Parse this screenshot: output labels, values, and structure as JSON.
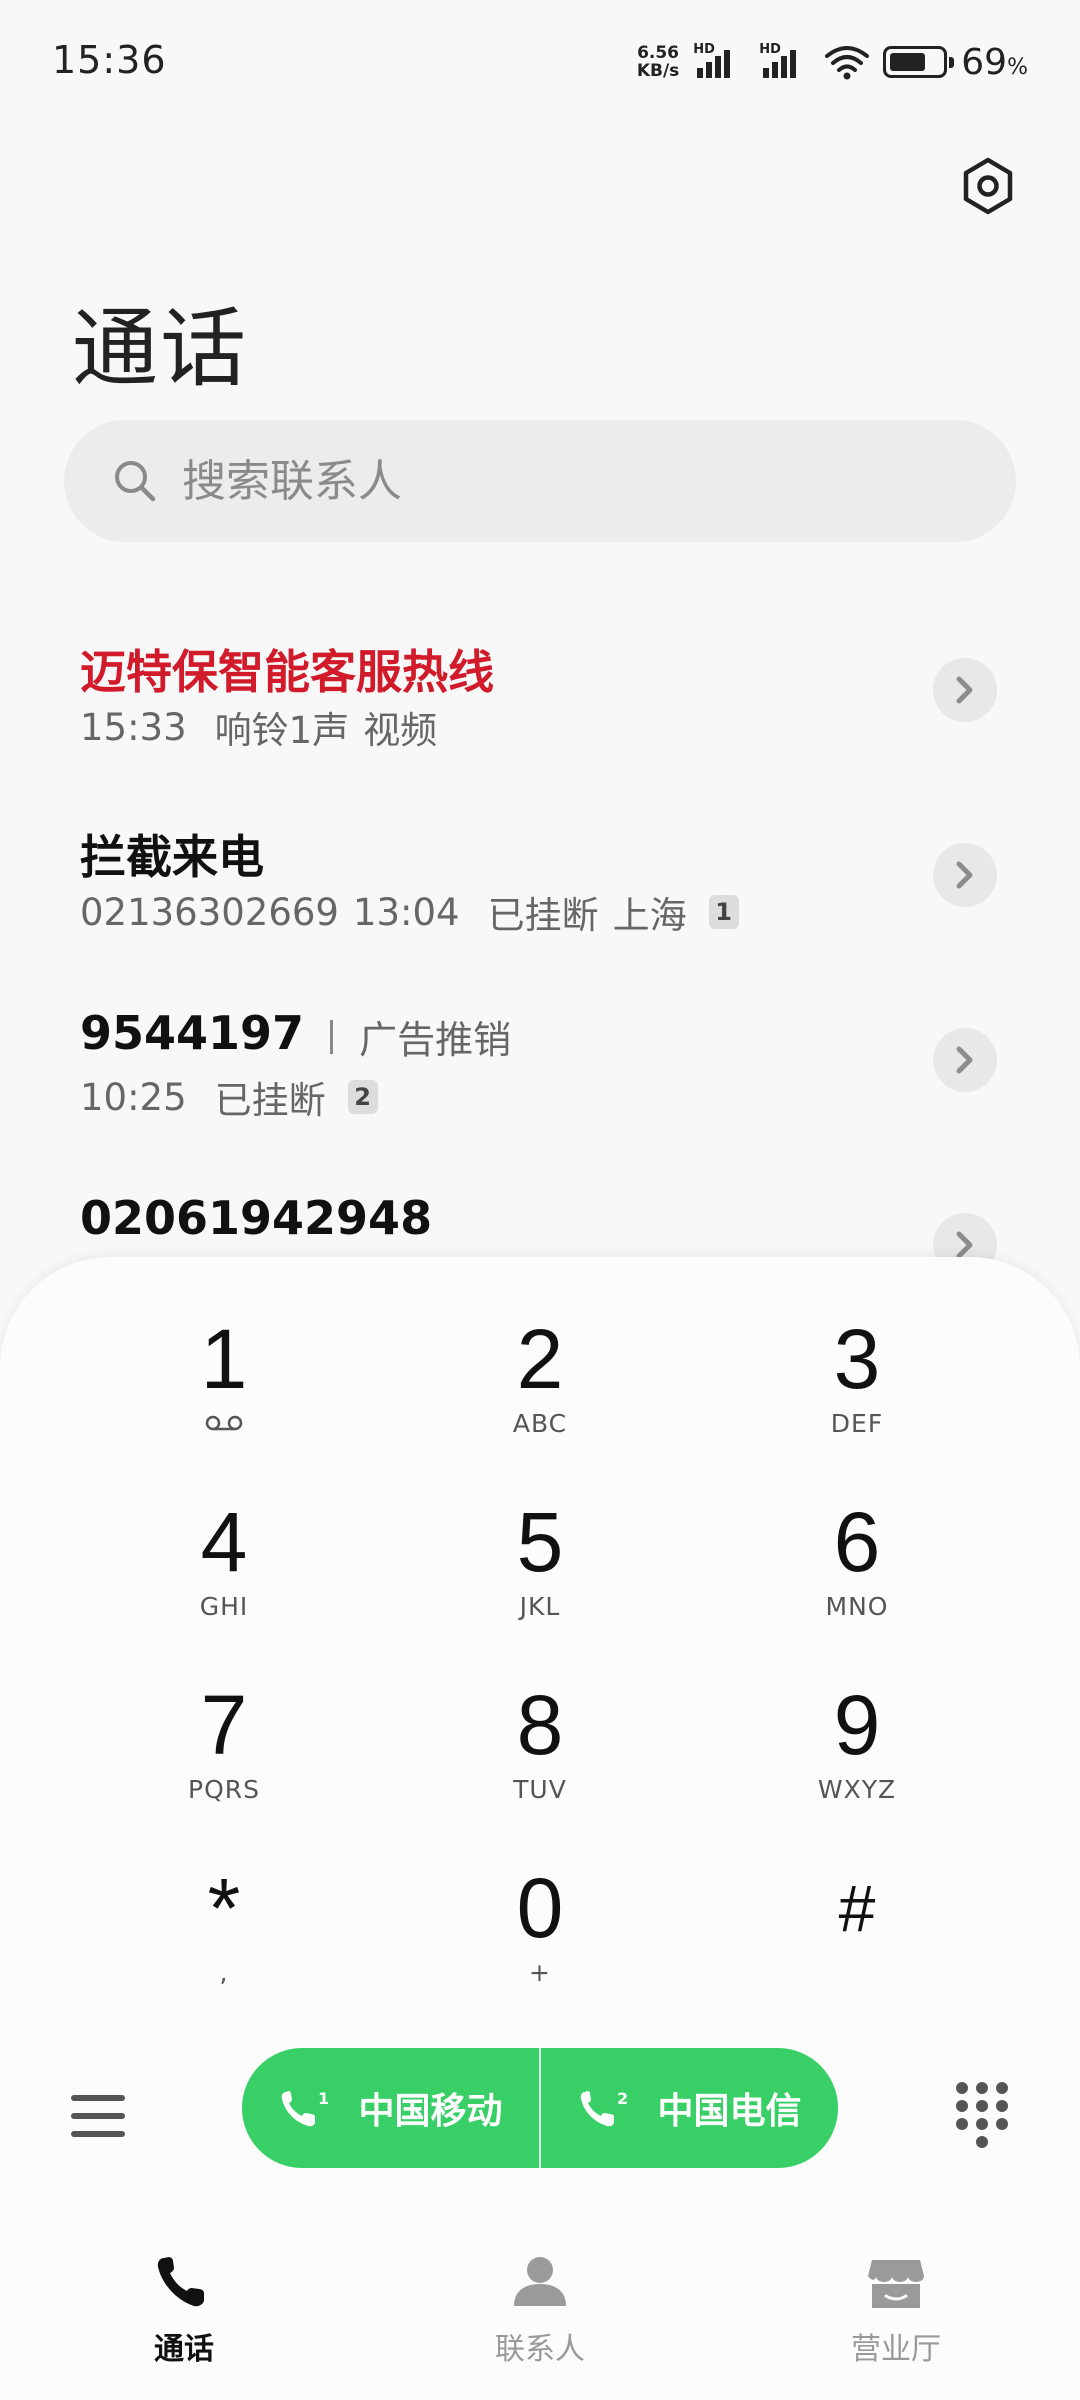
{
  "status_bar": {
    "time": "15:36",
    "net_speed_value": "6.56",
    "net_speed_unit": "KB/s",
    "sim1_label": "HD",
    "sim2_label": "HD",
    "battery_level_percent": 69,
    "battery_text": "69",
    "battery_unit": "%"
  },
  "header": {
    "title": "通话",
    "settings_icon": "gear-hex-icon"
  },
  "search": {
    "placeholder": "搜索联系人"
  },
  "calls": [
    {
      "name": "迈特保智能客服热线",
      "highlight_color": "#d11a2a",
      "time": "15:33",
      "status": "响铃1声",
      "type": "视频"
    },
    {
      "name": "拦截来电",
      "number": "02136302669",
      "time": "13:04",
      "status": "已挂断",
      "location": "上海",
      "count": "1"
    },
    {
      "name": "9544197",
      "tag": "广告推销",
      "time": "10:25",
      "status": "已挂断",
      "count": "2"
    },
    {
      "name": "02061942948"
    }
  ],
  "dialpad": {
    "keys": [
      {
        "digit": "1",
        "letters": ""
      },
      {
        "digit": "2",
        "letters": "ABC"
      },
      {
        "digit": "3",
        "letters": "DEF"
      },
      {
        "digit": "4",
        "letters": "GHI"
      },
      {
        "digit": "5",
        "letters": "JKL"
      },
      {
        "digit": "6",
        "letters": "MNO"
      },
      {
        "digit": "7",
        "letters": "PQRS"
      },
      {
        "digit": "8",
        "letters": "TUV"
      },
      {
        "digit": "9",
        "letters": "WXYZ"
      },
      {
        "digit": "*",
        "letters": ","
      },
      {
        "digit": "0",
        "letters": "+"
      },
      {
        "digit": "#",
        "letters": ""
      }
    ]
  },
  "actions": {
    "sim1_index": "1",
    "sim1_label": "中国移动",
    "sim2_index": "2",
    "sim2_label": "中国电信",
    "accent_color": "#37cf66"
  },
  "bottom_nav": {
    "items": [
      {
        "label": "通话",
        "icon": "phone-icon",
        "active": true
      },
      {
        "label": "联系人",
        "icon": "person-icon",
        "active": false
      },
      {
        "label": "营业厅",
        "icon": "store-icon",
        "active": false
      }
    ]
  }
}
